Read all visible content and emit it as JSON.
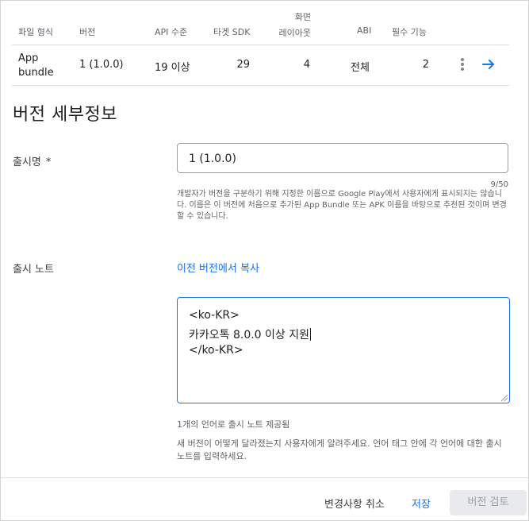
{
  "table": {
    "headers": {
      "file_type": "파일 형식",
      "version": "버전",
      "api_level": "API 수준",
      "target_sdk": "타겟 SDK",
      "screen_layout_1": "화면",
      "screen_layout_2": "레이아웃",
      "abi": "ABI",
      "required_features": "필수 기능"
    },
    "row": {
      "file_type_1": "App",
      "file_type_2": "bundle",
      "version": "1 (1.0.0)",
      "api_level": "19 이상",
      "target_sdk": "29",
      "screen_layout": "4",
      "abi": "전체",
      "required_features": "2"
    }
  },
  "section": {
    "title": "버전 세부정보"
  },
  "release_name": {
    "label": "출시명",
    "required_mark": "*",
    "value": "1 (1.0.0)",
    "counter": "9/50",
    "help": "개발자가 버전을 구분하기 위해 지정한 이름으로 Google Play에서 사용자에게 표시되지는 않습니다. 이름은 이 버전에 처음으로 추가된 App Bundle 또는 APK 이름을 바탕으로 추천된 것이며 변경할 수 있습니다."
  },
  "release_notes": {
    "label": "출시 노트",
    "copy_link": "이전 버전에서 복사",
    "lines": [
      "<ko-KR>",
      "카카오톡 8.0.0 이상 지원",
      "</ko-KR>"
    ],
    "languages_note": "1개의 언어로 출시 노트 제공됨",
    "help": "새 버전이 어떻게 달라졌는지 사용자에게 알려주세요. 언어 태그 안에 각 언어에 대한 출시 노트를 입력하세요."
  },
  "footer": {
    "discard": "변경사항 취소",
    "save": "저장",
    "review": "버전 검토"
  },
  "colors": {
    "accent": "#1a73e8",
    "disabled_bg": "#e8eaed",
    "disabled_text": "#9aa0a6"
  },
  "icons": {
    "more": "more-vert-icon",
    "go": "arrow-right-icon"
  }
}
